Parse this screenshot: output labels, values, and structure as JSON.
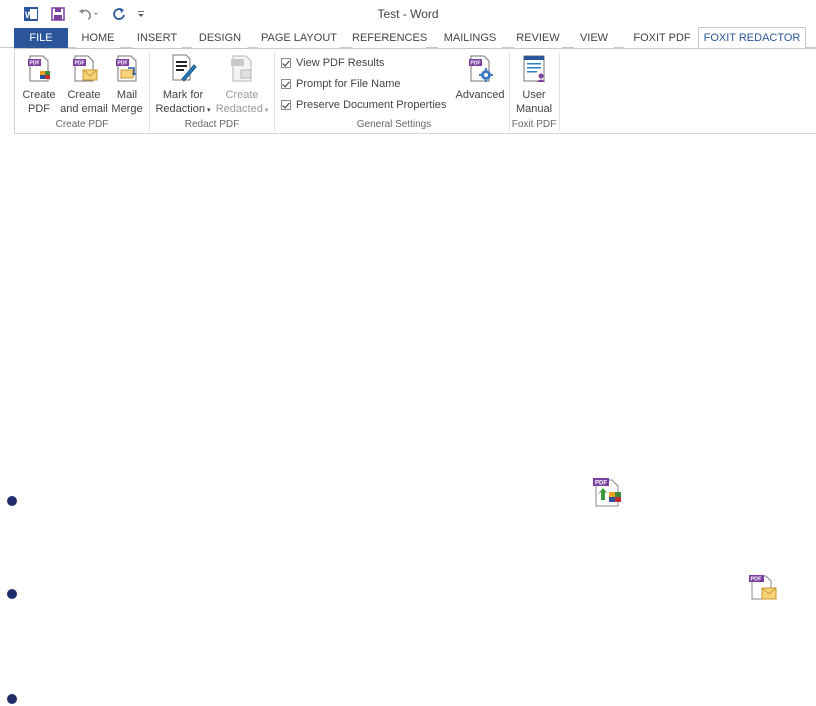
{
  "window": {
    "title": "Test - Word"
  },
  "quick_access": {
    "app_icon": "word-icon",
    "save": "save-icon",
    "undo": "undo-icon",
    "redo": "redo-icon",
    "customize": "customize-qat-icon"
  },
  "tabs": [
    {
      "label": "FILE"
    },
    {
      "label": "HOME"
    },
    {
      "label": "INSERT"
    },
    {
      "label": "DESIGN"
    },
    {
      "label": "PAGE LAYOUT"
    },
    {
      "label": "REFERENCES"
    },
    {
      "label": "MAILINGS"
    },
    {
      "label": "REVIEW"
    },
    {
      "label": "VIEW"
    },
    {
      "label": "FOXIT PDF"
    },
    {
      "label": "FOXIT REDACTOR"
    }
  ],
  "active_tab": "FOXIT REDACTOR",
  "ribbon": {
    "create_pdf_group": {
      "label": "Create PDF",
      "create_pdf": {
        "line1": "Create",
        "line2": "PDF"
      },
      "create_and_email": {
        "line1": "Create",
        "line2": "and email"
      },
      "mail_merge": {
        "line1": "Mail",
        "line2": "Merge"
      }
    },
    "redact_pdf_group": {
      "label": "Redact PDF",
      "mark_for_redaction": {
        "line1": "Mark for",
        "line2": "Redaction"
      },
      "create_redacted": {
        "line1": "Create",
        "line2": "Redacted"
      }
    },
    "general_settings_group": {
      "label": "General Settings",
      "view_pdf_results": "View PDF Results",
      "prompt_for_file_name": "Prompt for File Name",
      "preserve_document_properties": "Preserve Document Properties",
      "advanced": "Advanced"
    },
    "foxit_pdf_group": {
      "label": "Foxit PDF",
      "user_manual": {
        "line1": "User",
        "line2": "Manual"
      }
    }
  },
  "colors": {
    "accent": "#2b579a",
    "bullet": "#1f2d6b",
    "pdf_purple": "#7b3fa0"
  }
}
